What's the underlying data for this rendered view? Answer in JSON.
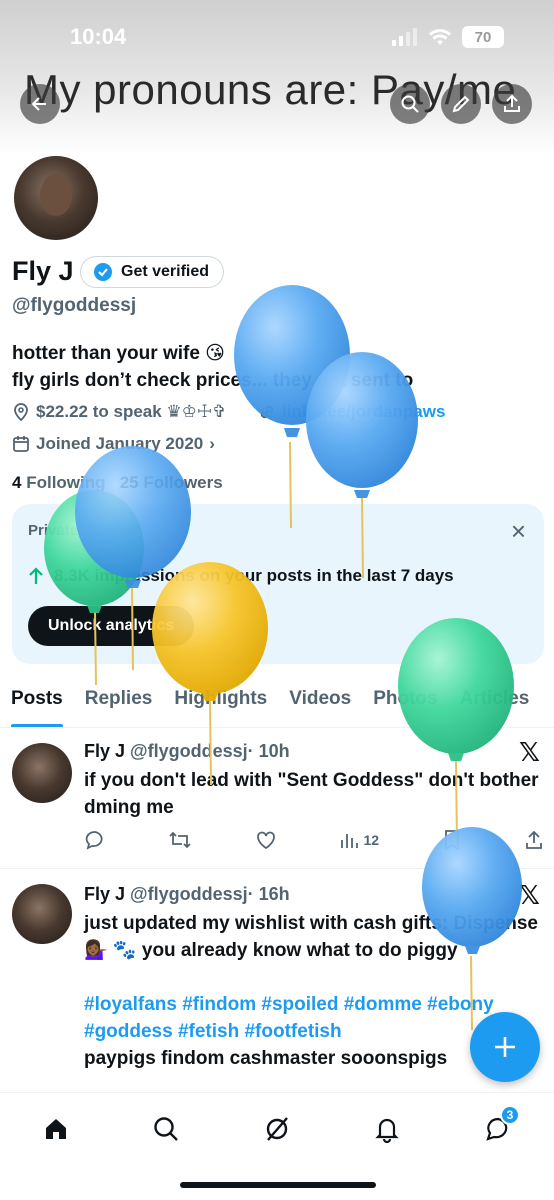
{
  "status_bar": {
    "time": "10:04",
    "battery": "70"
  },
  "banner": {
    "text": "My pronouns are: Pay/me"
  },
  "profile": {
    "name": "Fly J",
    "verify_label": "Get verified",
    "handle": "@flygoddessj",
    "bio_line1": "hotter than your wife 😘",
    "bio_line2": "fly girls don’t check prices... they get sent to",
    "location": "$22.22 to speak ♛♔☩✞",
    "link": "linktr.ee/jordanpaws",
    "joined": "Joined January 2020",
    "following_count": "4",
    "following_label": "Following",
    "followers_count": "25",
    "followers_label": "Followers"
  },
  "analytics": {
    "title": "Private to you",
    "stat_value": "8.3K",
    "stat_text": "impressions on your posts in the last 7 days",
    "button": "Unlock analytics"
  },
  "tabs": [
    "Posts",
    "Replies",
    "Highlights",
    "Videos",
    "Photos",
    "Articles"
  ],
  "posts": [
    {
      "name": "Fly J",
      "handle": "@flygoddessj",
      "time": "· 10h",
      "text": "if you don't lead with \"Sent Goddess\" don't bother dming me",
      "views": "12"
    },
    {
      "name": "Fly J",
      "handle": "@flygoddessj",
      "time": "· 16h",
      "text": "just updated my wishlist with cash gifts: Dispense 💁🏾‍♀️ 🐾 you already know what to do piggy",
      "hashtags": "#loyalfans #findom #spoiled #domme #ebony #goddess #fetish #footfetish",
      "tail": "paypigs findom cashmaster sooonspigs"
    }
  ],
  "nav": {
    "messages_badge": "3"
  },
  "colors": {
    "accent": "#1d9bf0",
    "balloon_blue": "#5aaaf2",
    "balloon_green": "#3fd89c",
    "balloon_yellow": "#f7c52a"
  }
}
